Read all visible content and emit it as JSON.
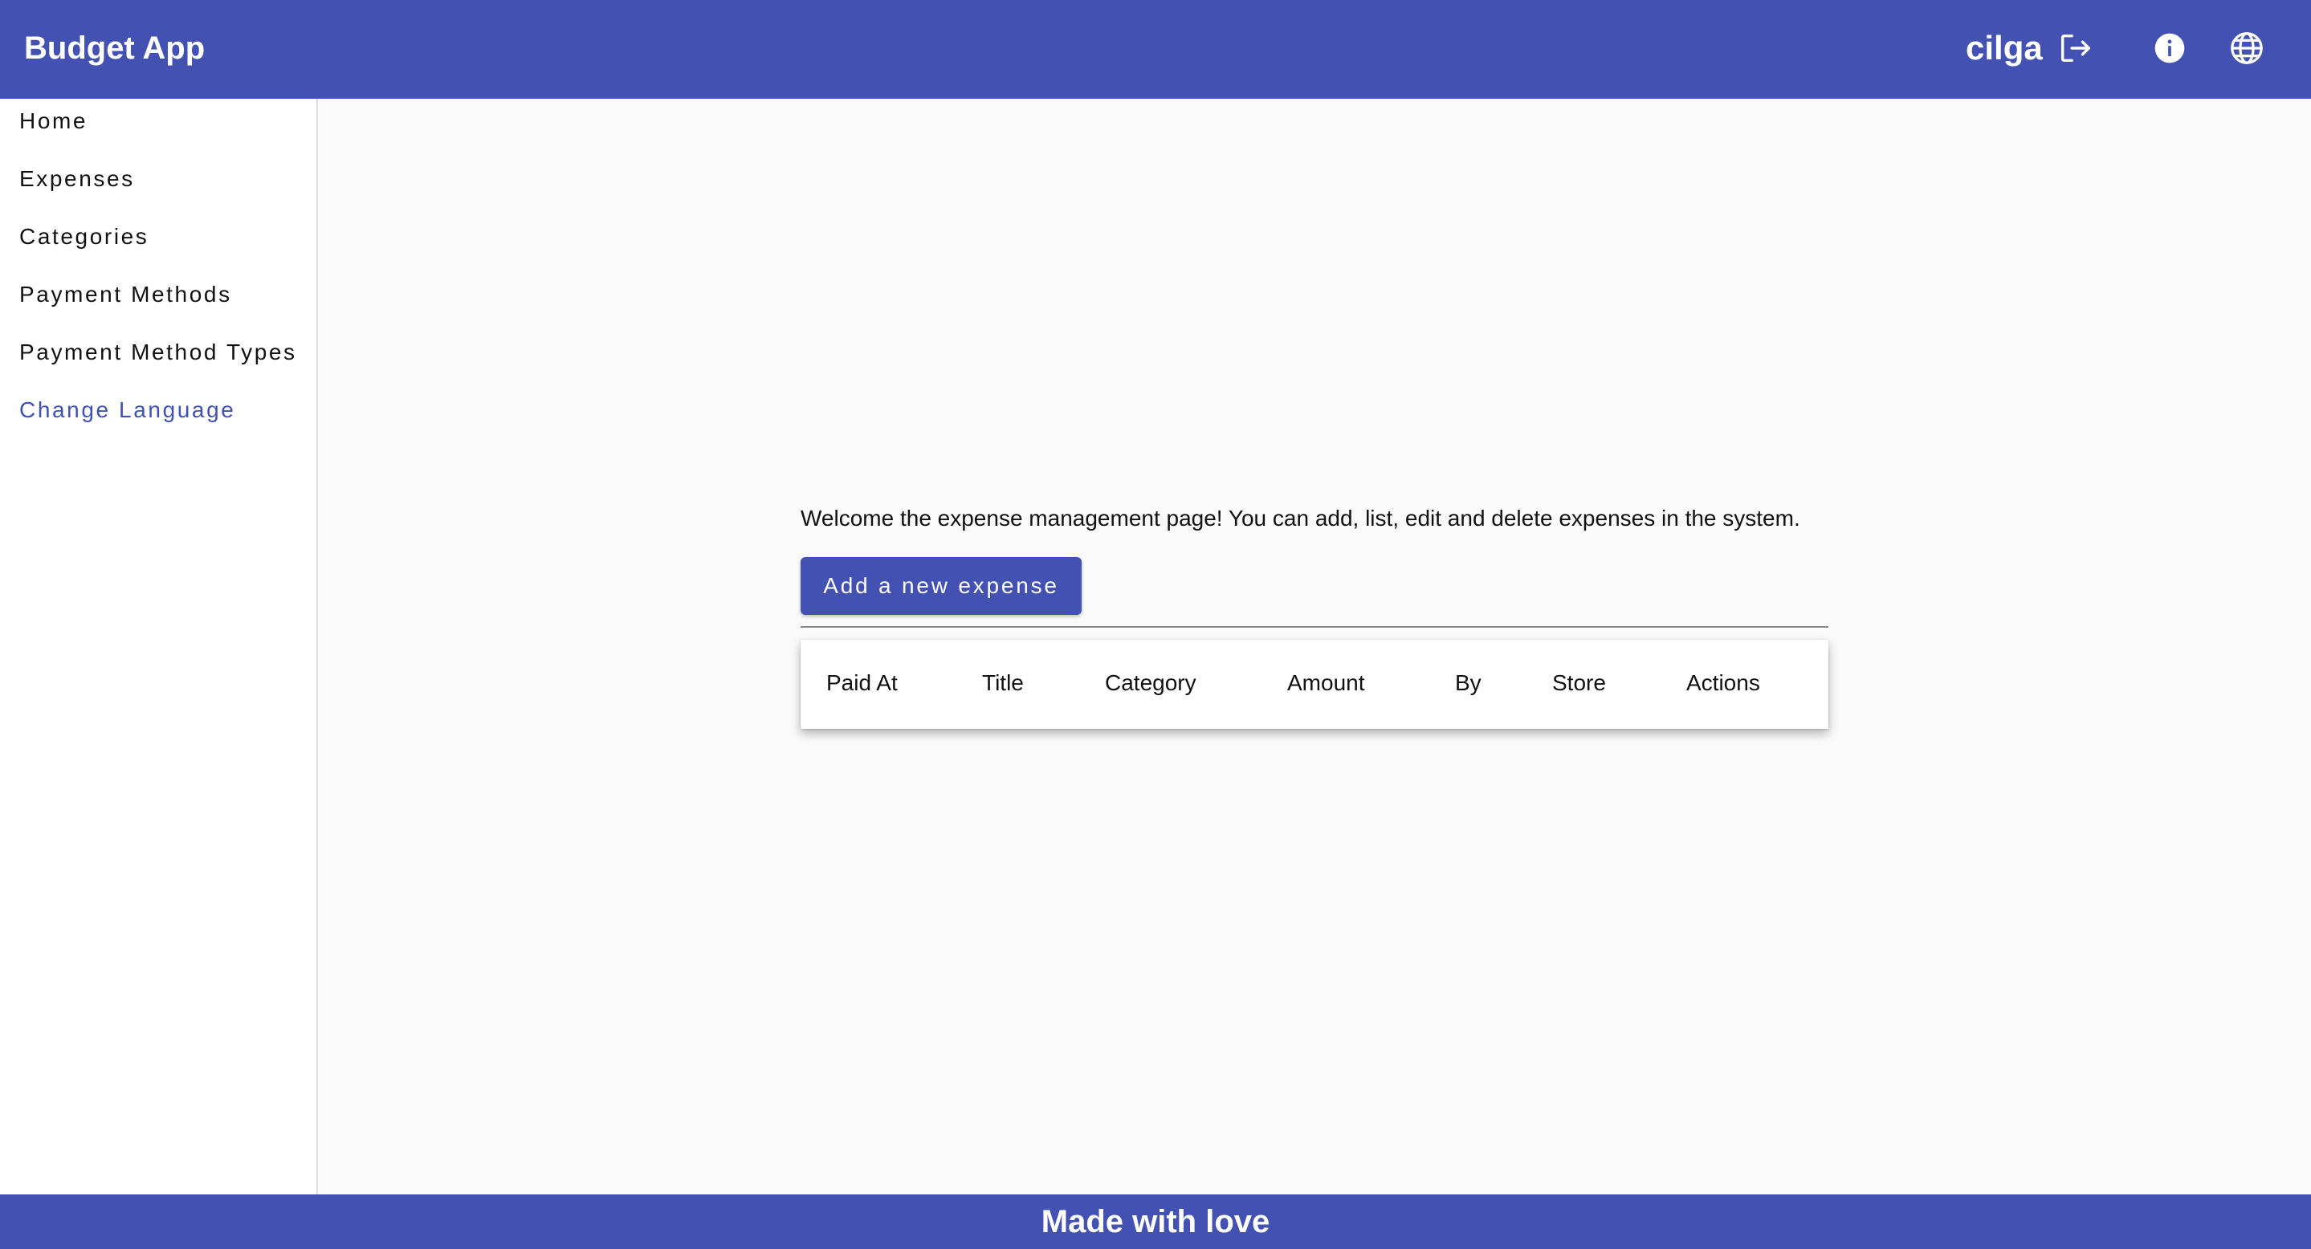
{
  "header": {
    "app_title": "Budget App",
    "user_name": "cilga",
    "logout_icon": "logout-icon",
    "info_icon": "info-icon",
    "language_icon": "globe-icon"
  },
  "sidebar": {
    "items": [
      {
        "label": "Home",
        "active": false
      },
      {
        "label": "Expenses",
        "active": false
      },
      {
        "label": "Categories",
        "active": false
      },
      {
        "label": "Payment Methods",
        "active": false
      },
      {
        "label": "Payment Method Types",
        "active": false
      },
      {
        "label": "Change Language",
        "active": true
      }
    ]
  },
  "main": {
    "welcome_text": "Welcome the expense management page! You can add, list, edit and delete expenses in the system.",
    "add_button_label": "Add a new expense",
    "table": {
      "columns": [
        "Paid At",
        "Title",
        "Category",
        "Amount",
        "By",
        "Store",
        "Actions"
      ],
      "rows": []
    }
  },
  "footer": {
    "text": "Made with love"
  },
  "colors": {
    "primary": "#4352b2",
    "active_link": "#3f51b5",
    "background": "#fafafa"
  }
}
